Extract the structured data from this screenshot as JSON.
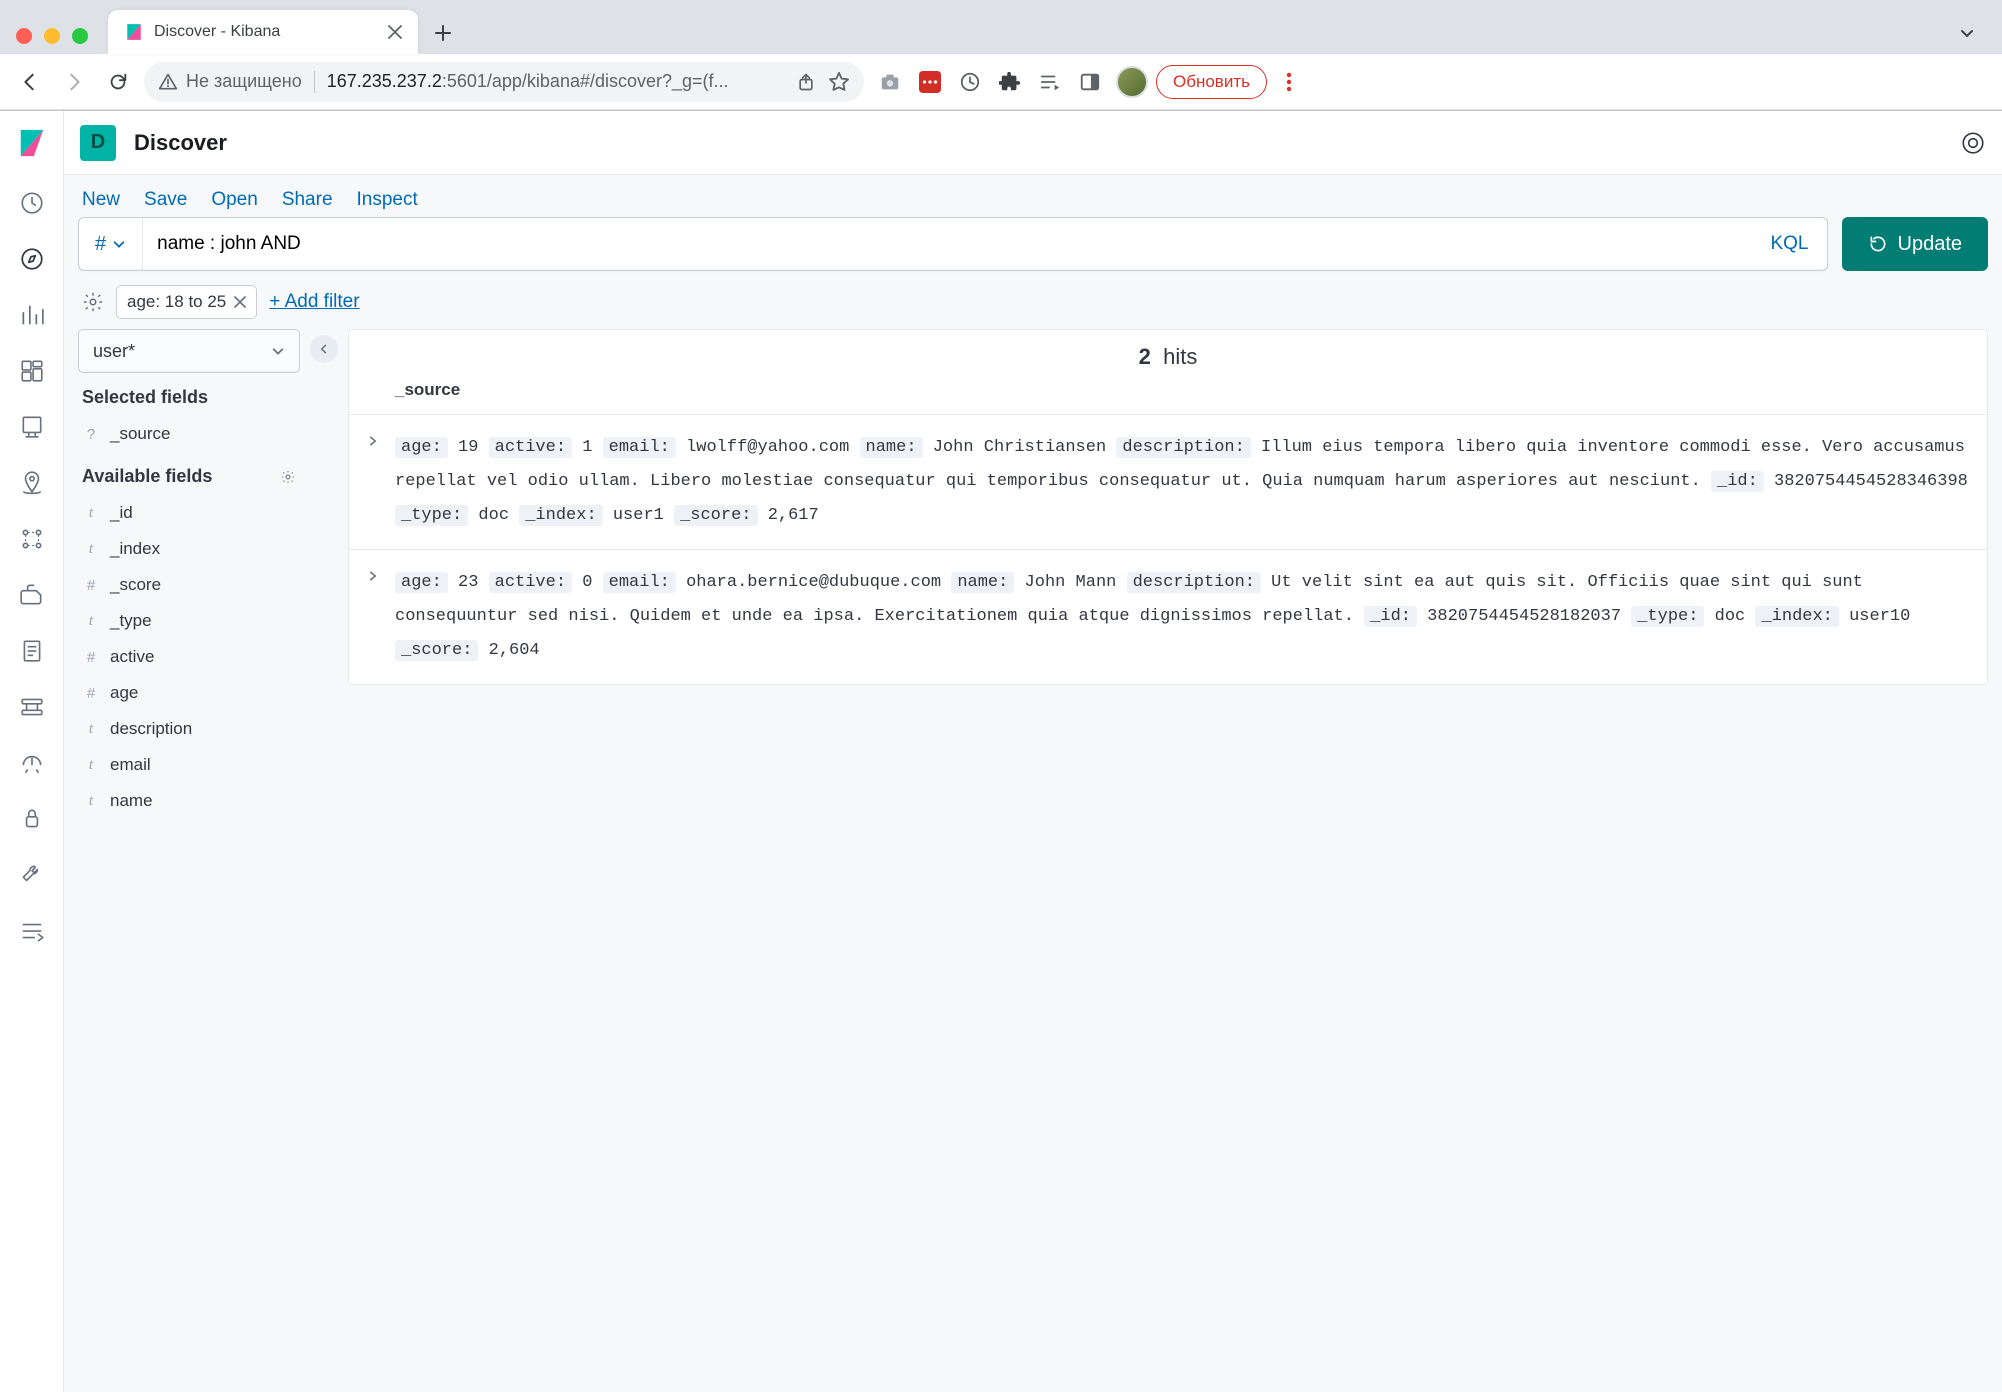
{
  "browser": {
    "tab_title": "Discover - Kibana",
    "insecure_label": "Не защищено",
    "url_host": "167.235.237.2",
    "url_path": ":5601/app/kibana#/discover?_g=(f...",
    "update_button": "Обновить"
  },
  "header": {
    "pill": "D",
    "title": "Discover"
  },
  "topmenu": {
    "new": "New",
    "save": "Save",
    "open": "Open",
    "share": "Share",
    "inspect": "Inspect"
  },
  "query": {
    "value": "name : john AND",
    "kql_label": "KQL",
    "update_label": "Update"
  },
  "filters": {
    "pill": "age: 18 to 25",
    "add_filter": "+ Add filter"
  },
  "index_pattern": "user*",
  "fields": {
    "selected_heading": "Selected fields",
    "available_heading": "Available fields",
    "selected": [
      {
        "type": "q",
        "name": "_source"
      }
    ],
    "available": [
      {
        "type": "t",
        "name": "_id"
      },
      {
        "type": "t",
        "name": "_index"
      },
      {
        "type": "hash",
        "name": "_score"
      },
      {
        "type": "t",
        "name": "_type"
      },
      {
        "type": "hash",
        "name": "active"
      },
      {
        "type": "hash",
        "name": "age"
      },
      {
        "type": "t",
        "name": "description"
      },
      {
        "type": "t",
        "name": "email"
      },
      {
        "type": "t",
        "name": "name"
      }
    ]
  },
  "results": {
    "count": "2",
    "hits_label": "hits",
    "source_header": "_source",
    "docs": [
      {
        "pairs": [
          {
            "k": "age:",
            "v": "19"
          },
          {
            "k": "active:",
            "v": "1"
          },
          {
            "k": "email:",
            "v": "lwolff@yahoo.com"
          },
          {
            "k": "name:",
            "v": "John Christiansen"
          },
          {
            "k": "description:",
            "v": "Illum eius tempora libero quia inventore commodi esse. Vero accusamus repellat vel odio ullam. Libero molestiae consequatur qui temporibus consequatur ut. Quia numquam harum asperiores aut nesciunt."
          },
          {
            "k": "_id:",
            "v": "3820754454528346398"
          },
          {
            "k": "_type:",
            "v": "doc"
          },
          {
            "k": "_index:",
            "v": "user1"
          },
          {
            "k": "_score:",
            "v": "2,617"
          }
        ]
      },
      {
        "pairs": [
          {
            "k": "age:",
            "v": "23"
          },
          {
            "k": "active:",
            "v": "0"
          },
          {
            "k": "email:",
            "v": "ohara.bernice@dubuque.com"
          },
          {
            "k": "name:",
            "v": "John Mann"
          },
          {
            "k": "description:",
            "v": "Ut velit sint ea aut quis sit. Officiis quae sint qui sunt consequuntur sed nisi. Quidem et unde ea ipsa. Exercitationem quia atque dignissimos repellat."
          },
          {
            "k": "_id:",
            "v": "3820754454528182037"
          },
          {
            "k": "_type:",
            "v": "doc"
          },
          {
            "k": "_index:",
            "v": "user10"
          },
          {
            "k": "_score:",
            "v": "2,604"
          }
        ]
      }
    ]
  }
}
